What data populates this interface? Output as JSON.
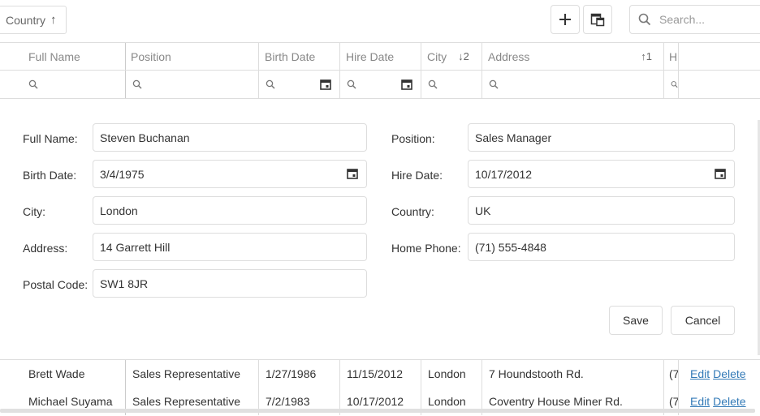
{
  "toolbar": {
    "group_chip_label": "Country",
    "search_placeholder": "Search..."
  },
  "columns": [
    "Full Name",
    "Position",
    "Birth Date",
    "Hire Date",
    "City",
    "Address",
    "H"
  ],
  "sort": {
    "city_indicator": "↓2",
    "address_indicator": "↑1",
    "group_indicator": "↑"
  },
  "form": {
    "full_name_label": "Full Name:",
    "full_name": "Steven Buchanan",
    "position_label": "Position:",
    "position": "Sales Manager",
    "birth_date_label": "Birth Date:",
    "birth_date": "3/4/1975",
    "hire_date_label": "Hire Date:",
    "hire_date": "10/17/2012",
    "city_label": "City:",
    "city": "London",
    "country_label": "Country:",
    "country": "UK",
    "address_label": "Address:",
    "address": "14 Garrett Hill",
    "home_phone_label": "Home Phone:",
    "home_phone": "(71) 555-4848",
    "postal_code_label": "Postal Code:",
    "postal_code": "SW1 8JR",
    "save_label": "Save",
    "cancel_label": "Cancel"
  },
  "rows": [
    {
      "full_name": "Brett Wade",
      "position": "Sales Representative",
      "birth_date": "1/27/1986",
      "hire_date": "11/15/2012",
      "city": "London",
      "address": "7 Houndstooth Rd.",
      "phone_partial": "(7",
      "edit": "Edit",
      "delete": "Delete"
    },
    {
      "full_name": "Michael Suyama",
      "position": "Sales Representative",
      "birth_date": "7/2/1983",
      "hire_date": "10/17/2012",
      "city": "London",
      "address": "Coventry House Miner Rd.",
      "phone_partial": "(7",
      "edit": "Edit",
      "delete": "Delete"
    }
  ],
  "colors": {
    "border": "#dddddd",
    "link": "#337ab7",
    "text": "#333333",
    "header_text": "#888888"
  }
}
